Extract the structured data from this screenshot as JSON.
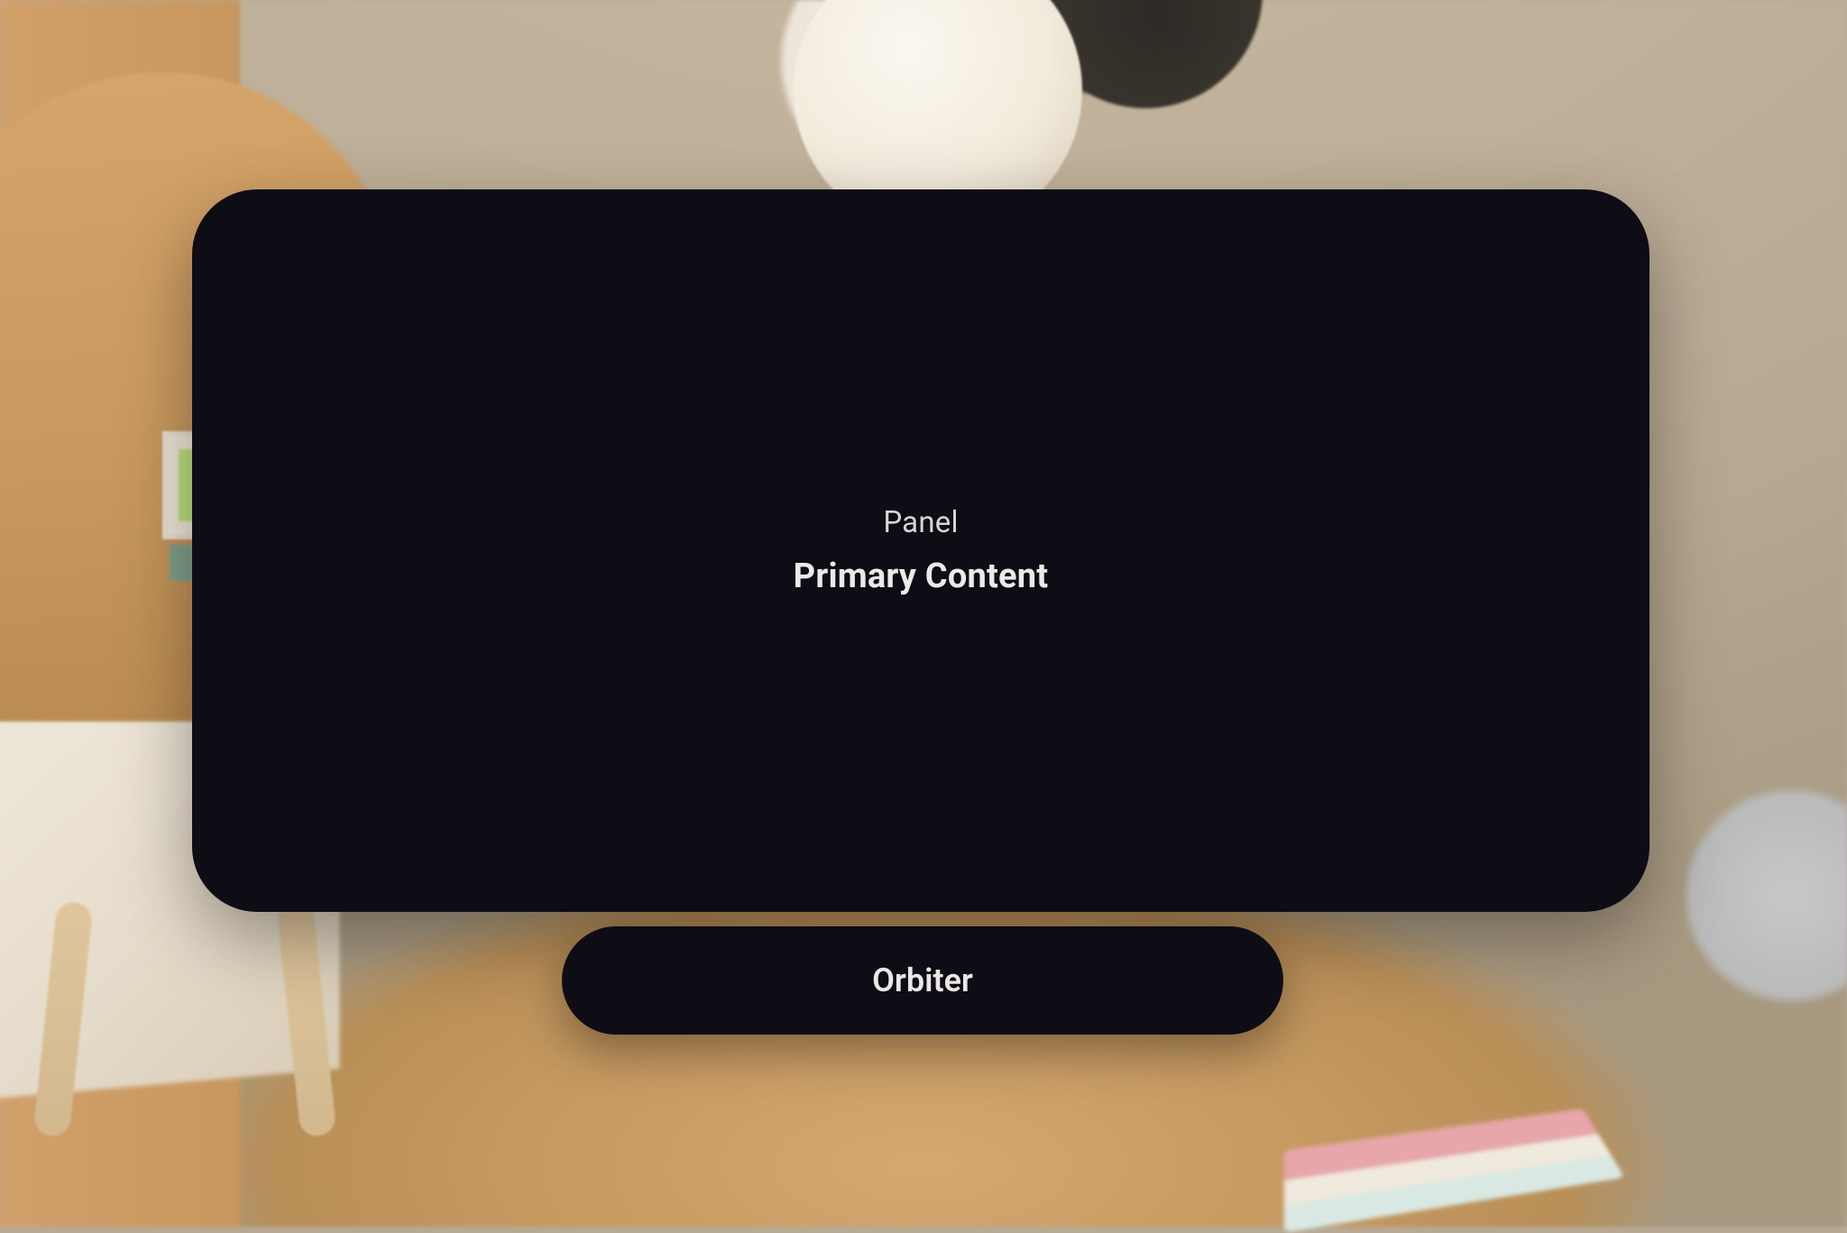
{
  "panel": {
    "label": "Panel",
    "title": "Primary Content"
  },
  "orbiter": {
    "label": "Orbiter"
  },
  "colors": {
    "surface": "#0e0c15",
    "text_primary": "#eceae8",
    "text_secondary": "#d9d5d2"
  }
}
